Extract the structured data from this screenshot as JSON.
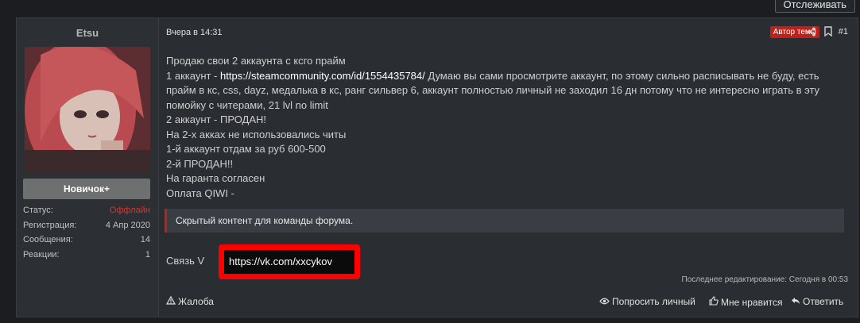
{
  "top": {
    "watch_label": "Отслеживать"
  },
  "user": {
    "name": "Etsu",
    "rank": "Новичок+",
    "stats": [
      {
        "label": "Статус:",
        "value": "Оффлайн"
      },
      {
        "label": "Регистрация:",
        "value": "4 Апр 2020"
      },
      {
        "label": "Сообщения:",
        "value": "14"
      },
      {
        "label": "Реакции:",
        "value": "1"
      }
    ]
  },
  "post": {
    "date": "Вчера в 14:31",
    "author_badge": "Автор темы",
    "number": "#1",
    "lines": {
      "l1": "Продаю свои 2 аккаунта с ксго прайм",
      "l2_prefix": "1 аккаунт - ",
      "l2_link": "https://steamcommunity.com/id/1554435784/",
      "l2_rest": " Думаю вы сами просмотрите аккаунт, по этому сильно расписывать не буду, есть прайм в кс, css, dayz, медалька в кс, ранг сильвер 6, аккаунт полностью личный не заходил 16 дн потому что не интересно играть в эту помойку с читерами, 21 lvl no limit",
      "l3": "2 аккаунт - ПРОДАН!",
      "l4": "На 2-х акках не использовались читы",
      "l5": "1-й аккаунт отдам за руб 600-500",
      "l6": "2-й ПРОДАН!!",
      "l7": "На гаранта согласен",
      "l8": "Оплата QIWI -"
    },
    "hidden_content": "Скрытый контент для команды форума.",
    "contact_prefix": "Связь V",
    "contact_link": "https://vk.com/xxcykov",
    "edited": "Последнее редактирование: Сегодня в 00:53"
  },
  "footer": {
    "report": "Жалоба",
    "request_personal": "Попросить личный",
    "like": "Мне нравится",
    "reply": "Ответить"
  },
  "colors": {
    "accent_red": "#c0201a",
    "offline_red": "#d9342b",
    "highlight_red": "#ff0000"
  },
  "icons": [
    "share-icon",
    "bookmark-icon",
    "warning-icon",
    "eye-icon",
    "thumbs-up-icon",
    "reply-icon"
  ]
}
